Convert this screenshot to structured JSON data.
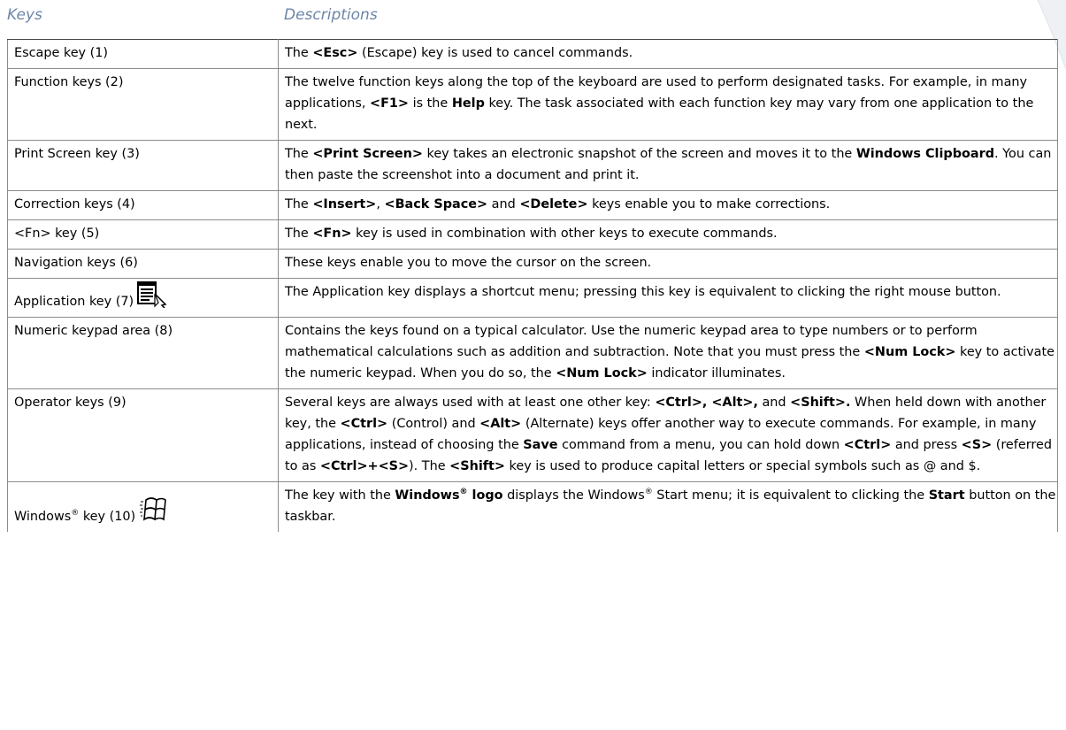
{
  "header": {
    "keys": "Keys",
    "descriptions": "Descriptions"
  },
  "rows": [
    {
      "key": "Escape key (1)",
      "desc": [
        {
          "t": "The "
        },
        {
          "t": "<Esc>",
          "b": true
        },
        {
          "t": " (Escape) key is used to cancel commands."
        }
      ]
    },
    {
      "key": "Function keys (2)",
      "desc": [
        {
          "t": "The twelve function keys along the top of the keyboard are used to perform designated tasks. For example, in many applications, "
        },
        {
          "t": "<F1>",
          "b": true
        },
        {
          "t": " is the "
        },
        {
          "t": "Help",
          "b": true
        },
        {
          "t": " key. The task associated with each function key may vary from one application to the next."
        }
      ]
    },
    {
      "key": "Print Screen key (3)",
      "desc": [
        {
          "t": "The "
        },
        {
          "t": "<Print Screen>",
          "b": true
        },
        {
          "t": " key takes an electronic snapshot of the screen and moves it to the "
        },
        {
          "t": "Windows Clipboard",
          "b": true
        },
        {
          "t": ". You can then paste the screenshot into a document and print it."
        }
      ]
    },
    {
      "key": "Correction keys (4)",
      "desc": [
        {
          "t": "The "
        },
        {
          "t": "<Insert>",
          "b": true
        },
        {
          "t": ", "
        },
        {
          "t": "<Back Space>",
          "b": true
        },
        {
          "t": " and "
        },
        {
          "t": "<Delete>",
          "b": true
        },
        {
          "t": " keys enable you to make corrections."
        }
      ]
    },
    {
      "key": "<Fn> key (5)",
      "desc": [
        {
          "t": "The "
        },
        {
          "t": "<Fn>",
          "b": true
        },
        {
          "t": " key is used in combination with other keys to execute commands."
        }
      ]
    },
    {
      "key": "Navigation keys (6)",
      "desc": [
        {
          "t": "These keys enable you to move the cursor on the screen."
        }
      ]
    },
    {
      "key": "Application key (7)",
      "icon": "application-key-icon",
      "desc": [
        {
          "t": "The Application key displays a shortcut menu; pressing this key is equivalent to clicking the right mouse button."
        }
      ]
    },
    {
      "key": "Numeric keypad area (8)",
      "desc": [
        {
          "t": "Contains the keys found on a typical calculator. Use the numeric keypad area to type numbers or to perform mathematical calculations such as addition and subtraction. Note that you must press the "
        },
        {
          "t": "<Num Lock>",
          "b": true
        },
        {
          "t": " key to activate the numeric keypad. When you do so, the "
        },
        {
          "t": "<Num Lock>",
          "b": true
        },
        {
          "t": " indicator illuminates."
        }
      ]
    },
    {
      "key": "Operator keys (9)",
      "desc": [
        {
          "t": "Several keys are always used with at least one other key:  "
        },
        {
          "t": "<Ctrl>, <Alt>,",
          "b": true
        },
        {
          "t": " and "
        },
        {
          "t": "<Shift>.",
          "b": true
        },
        {
          "t": " When held down with another key, the "
        },
        {
          "t": "<Ctrl>",
          "b": true
        },
        {
          "t": " (Control) and "
        },
        {
          "t": "<Alt>",
          "b": true
        },
        {
          "t": " (Alternate) keys offer another way to execute commands. For example, in many applications, instead of choosing the "
        },
        {
          "t": "Save",
          "b": true
        },
        {
          "t": " command from a menu, you can hold down "
        },
        {
          "t": "<Ctrl>",
          "b": true
        },
        {
          "t": " and press "
        },
        {
          "t": "<S>",
          "b": true
        },
        {
          "t": " (referred to as "
        },
        {
          "t": "<Ctrl>+<S>",
          "b": true
        },
        {
          "t": "). The "
        },
        {
          "t": "<Shift>",
          "b": true
        },
        {
          "t": " key is used to produce capital letters or special symbols such as @ and $."
        }
      ]
    },
    {
      "key": "Windows",
      "key_sup": "®",
      "key_after": " key (10)",
      "icon": "windows-logo-icon",
      "desc": [
        {
          "t": "The key with the "
        },
        {
          "t": "Windows",
          "b": true
        },
        {
          "t": "®",
          "b": true,
          "sup": true
        },
        {
          "t": " logo",
          "b": true
        },
        {
          "t": " displays the Windows"
        },
        {
          "t": "®",
          "sup": true
        },
        {
          "t": " Start menu; it is equivalent to clicking the "
        },
        {
          "t": "Start",
          "b": true
        },
        {
          "t": " button on the taskbar."
        }
      ]
    }
  ]
}
